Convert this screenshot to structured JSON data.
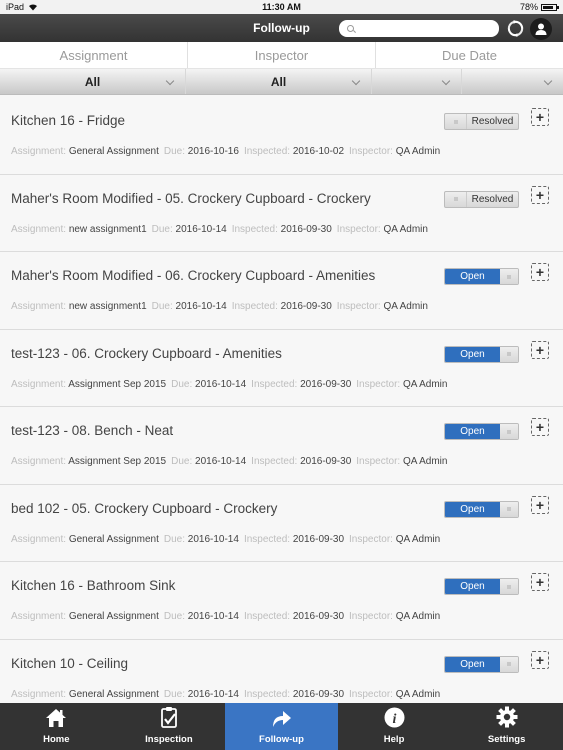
{
  "status_bar": {
    "device": "iPad",
    "time": "11:30 AM",
    "battery": "78%"
  },
  "nav": {
    "title": "Follow-up",
    "search_placeholder": ""
  },
  "filters": {
    "headers": [
      "Assignment",
      "Inspector",
      "Due Date"
    ],
    "assignment_value": "All",
    "inspector_value": "All",
    "due_from_value": "",
    "due_to_value": ""
  },
  "labels": {
    "assignment": "Assignment:",
    "due": "Due:",
    "inspected": "Inspected:",
    "inspector": "Inspector:"
  },
  "items": [
    {
      "title": "Kitchen 16 - Fridge",
      "assignment": "General Assignment",
      "due": "2016-10-16",
      "inspected": "2016-10-02",
      "inspector": "QA Admin",
      "status": "Resolved"
    },
    {
      "title": "Maher's Room Modified - 05. Crockery Cupboard - Crockery",
      "assignment": "new assignment1",
      "due": "2016-10-14",
      "inspected": "2016-09-30",
      "inspector": "QA Admin",
      "status": "Resolved"
    },
    {
      "title": "Maher's Room Modified - 06. Crockery Cupboard - Amenities",
      "assignment": "new assignment1",
      "due": "2016-10-14",
      "inspected": "2016-09-30",
      "inspector": "QA Admin",
      "status": "Open"
    },
    {
      "title": "test-123 - 06. Crockery Cupboard - Amenities",
      "assignment": "Assignment Sep 2015",
      "due": "2016-10-14",
      "inspected": "2016-09-30",
      "inspector": "QA Admin",
      "status": "Open"
    },
    {
      "title": "test-123 - 08. Bench - Neat",
      "assignment": "Assignment Sep 2015",
      "due": "2016-10-14",
      "inspected": "2016-09-30",
      "inspector": "QA Admin",
      "status": "Open"
    },
    {
      "title": "bed 102 - 05. Crockery Cupboard - Crockery",
      "assignment": "General Assignment",
      "due": "2016-10-14",
      "inspected": "2016-09-30",
      "inspector": "QA Admin",
      "status": "Open"
    },
    {
      "title": "Kitchen 16 - Bathroom Sink",
      "assignment": "General Assignment",
      "due": "2016-10-14",
      "inspected": "2016-09-30",
      "inspector": "QA Admin",
      "status": "Open"
    },
    {
      "title": "Kitchen 10 - Ceiling",
      "assignment": "General Assignment",
      "due": "2016-10-14",
      "inspected": "2016-09-30",
      "inspector": "QA Admin",
      "status": "Open"
    }
  ],
  "tabs": [
    {
      "label": "Home",
      "icon": "home-icon",
      "active": false
    },
    {
      "label": "Inspection",
      "icon": "clipboard-check-icon",
      "active": false
    },
    {
      "label": "Follow-up",
      "icon": "share-arrow-icon",
      "active": true
    },
    {
      "label": "Help",
      "icon": "info-icon",
      "active": false
    },
    {
      "label": "Settings",
      "icon": "gear-icon",
      "active": false
    }
  ],
  "colors": {
    "accent": "#3a75c4",
    "open_toggle": "#2f6fbe",
    "nav_bg": "#3d3d3d",
    "tab_bar_bg": "#333333"
  }
}
